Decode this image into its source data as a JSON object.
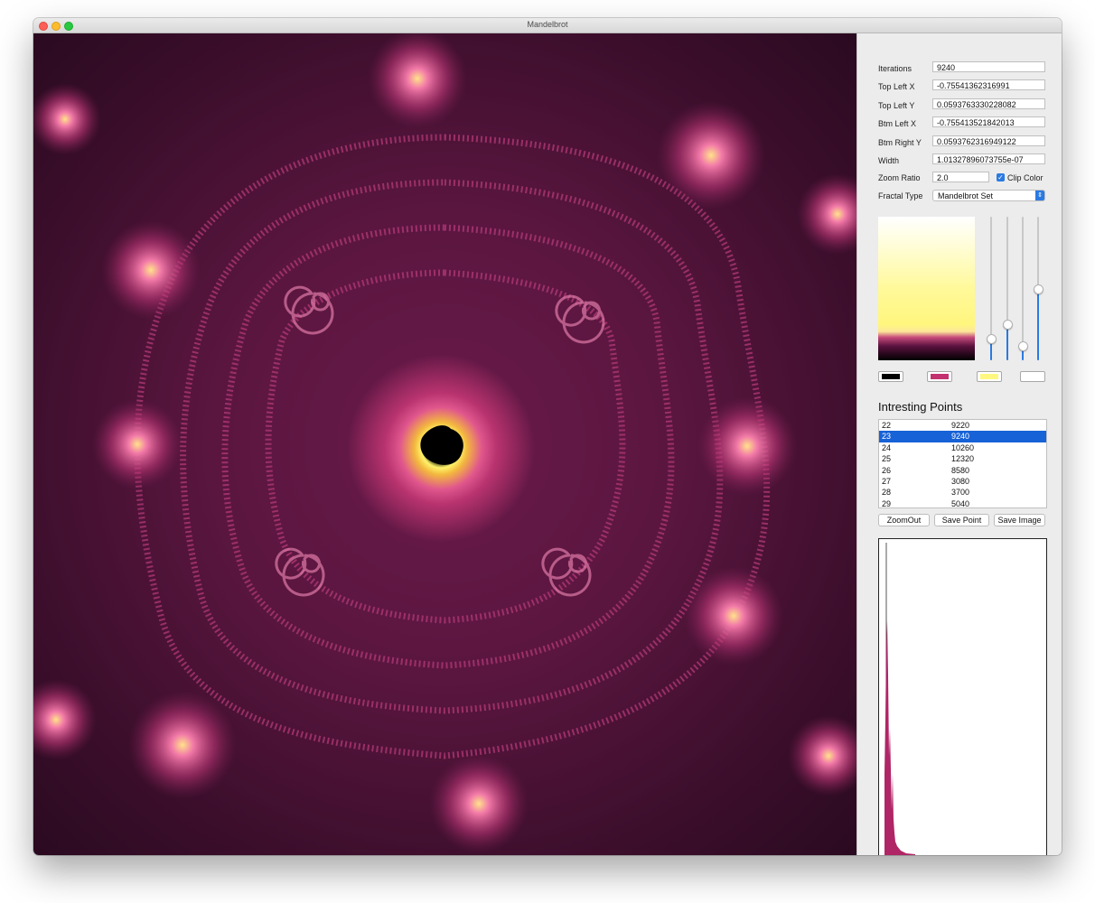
{
  "window": {
    "title": "Mandelbrot"
  },
  "fields": {
    "iterations": {
      "label": "Iterations",
      "value": "9240"
    },
    "top_left_x": {
      "label": "Top Left X",
      "value": "-0.75541362316991"
    },
    "top_left_y": {
      "label": "Top Left Y",
      "value": "0.0593763330228082"
    },
    "btm_left_x": {
      "label": "Btm Left X",
      "value": "-0.755413521842013"
    },
    "btm_right_y": {
      "label": "Btm Right Y",
      "value": "0.0593762316949122"
    },
    "width": {
      "label": "Width",
      "value": "1.01327896073755e-07"
    },
    "zoom_ratio": {
      "label": "Zoom Ratio",
      "value": "2.0"
    },
    "clip_color": {
      "label": "Clip Color",
      "checked": true
    },
    "fractal_type": {
      "label": "Fractal Type",
      "value": "Mandelbrot Set"
    }
  },
  "palette": {
    "sliders": [
      0.15,
      0.25,
      0.1,
      0.5
    ],
    "swatches": [
      "#000000",
      "#c2306f",
      "#fff780",
      "#ffffff"
    ]
  },
  "points": {
    "title": "Intresting Points",
    "rows": [
      {
        "id": "22",
        "iterations": "9220"
      },
      {
        "id": "23",
        "iterations": "9240",
        "selected": true
      },
      {
        "id": "24",
        "iterations": "10260"
      },
      {
        "id": "25",
        "iterations": "12320"
      },
      {
        "id": "26",
        "iterations": "8580"
      },
      {
        "id": "27",
        "iterations": "3080"
      },
      {
        "id": "28",
        "iterations": "3700"
      },
      {
        "id": "29",
        "iterations": "5040"
      }
    ]
  },
  "buttons": {
    "zoom_out": "ZoomOut",
    "save_point": "Save Point",
    "save_image": "Save Image"
  },
  "colors": {
    "selection": "#1762d7",
    "accent": "#2a7ae2"
  }
}
